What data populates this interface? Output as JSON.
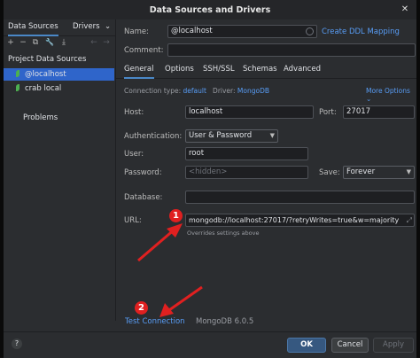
{
  "window": {
    "title": "Data Sources and Drivers",
    "close_glyph": "✕"
  },
  "sidebar": {
    "tabs": [
      "Data Sources",
      "Drivers"
    ],
    "tab_menu_glyph": "⌄",
    "toolbar": {
      "add": "+",
      "remove": "−",
      "copy": "⧉",
      "settings": "🔧",
      "import": "⤓",
      "back": "←",
      "forward": "→"
    },
    "heading": "Project Data Sources",
    "items": [
      {
        "label": "@localhost",
        "selected": true
      },
      {
        "label": "crab local",
        "selected": false
      }
    ],
    "problems": "Problems"
  },
  "form": {
    "name_label": "Name:",
    "name_value": "@localhost",
    "create_ddl": "Create DDL Mapping",
    "comment_label": "Comment:",
    "comment_value": "",
    "tabs": [
      "General",
      "Options",
      "SSH/SSL",
      "Schemas",
      "Advanced"
    ],
    "connection_type_label": "Connection type:",
    "connection_type_value": "default",
    "driver_label": "Driver:",
    "driver_value": "MongoDB",
    "more_options": "More Options",
    "host_label": "Host:",
    "host_value": "localhost",
    "port_label": "Port:",
    "port_value": "27017",
    "auth_label": "Authentication:",
    "auth_value": "User & Password",
    "user_label": "User:",
    "user_value": "root",
    "password_label": "Password:",
    "password_placeholder": "<hidden>",
    "save_label": "Save:",
    "save_value": "Forever",
    "database_label": "Database:",
    "database_value": "",
    "url_label": "URL:",
    "url_value": "mongodb://localhost:27017/?retryWrites=true&w=majority",
    "url_note": "Overrides settings above",
    "test_connection": "Test Connection",
    "driver_version": "MongoDB 6.0.5"
  },
  "buttons": {
    "help": "?",
    "ok": "OK",
    "cancel": "Cancel",
    "apply": "Apply"
  },
  "annotations": {
    "badge1": "1",
    "badge2": "2"
  },
  "colors": {
    "accent": "#4a88c7",
    "selection": "#2f65ca",
    "link": "#589df6",
    "annotation": "#e02020",
    "leaf": "#4caf50"
  }
}
